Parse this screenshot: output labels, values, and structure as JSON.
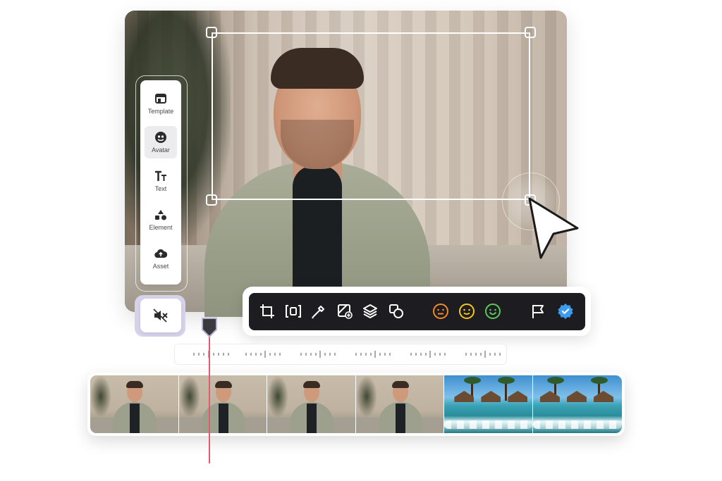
{
  "sidebar": {
    "items": [
      {
        "label": "Template",
        "icon": "template-icon"
      },
      {
        "label": "Avatar",
        "icon": "avatar-icon"
      },
      {
        "label": "Text",
        "icon": "text-icon"
      },
      {
        "label": "Element",
        "icon": "shapes-icon"
      },
      {
        "label": "Asset",
        "icon": "cloud-upload-icon"
      }
    ],
    "active_item": "Avatar"
  },
  "mute_button": {
    "icon": "speaker-muted-icon"
  },
  "toolbar": {
    "icons": [
      "crop-icon",
      "aspect-ratio-icon",
      "eyedropper-icon",
      "image-add-icon",
      "layers-icon",
      "shapes-icon",
      "neutral-face-icon",
      "smile-face-icon",
      "happy-face-icon",
      "flag-icon",
      "verified-badge-icon"
    ],
    "colors": {
      "background": "#1d1d21",
      "neutral_face": "#f08a2c",
      "smile_face": "#f5c518",
      "happy_face": "#5cc85a",
      "verified_badge": "#3b9cf0"
    }
  },
  "timeline": {
    "frames": [
      "avatar",
      "avatar",
      "avatar",
      "avatar",
      "beach",
      "beach"
    ],
    "playhead_color": "#e05a70"
  }
}
